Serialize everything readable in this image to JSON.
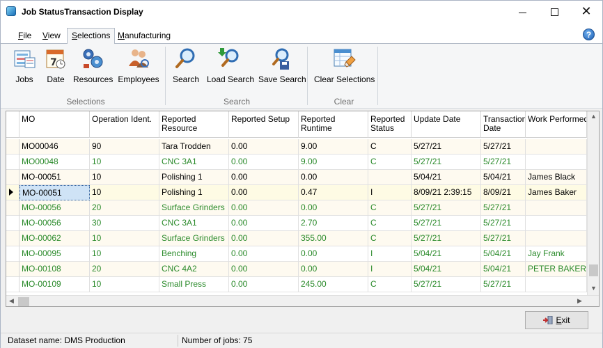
{
  "window": {
    "title": "Job StatusTransaction Display",
    "minimize_glyph": "",
    "close_glyph": "✕"
  },
  "menu": {
    "tabs": [
      {
        "label": "File",
        "underline": "F"
      },
      {
        "label": "View",
        "underline": "V"
      },
      {
        "label": "Selections",
        "underline": "S"
      },
      {
        "label": "Manufacturing",
        "underline": "M"
      }
    ],
    "help_glyph": "?"
  },
  "ribbon": {
    "groups": [
      {
        "label": "Selections",
        "buttons": [
          {
            "label": "Jobs",
            "icon": "jobs-icon"
          },
          {
            "label": "Date",
            "icon": "calendar-icon"
          },
          {
            "label": "Resources",
            "icon": "resources-gear-icon"
          },
          {
            "label": "Employees",
            "icon": "employees-icon"
          }
        ]
      },
      {
        "label": "Search",
        "buttons": [
          {
            "label": "Search",
            "icon": "magnifier-icon"
          },
          {
            "label": "Load Search",
            "icon": "load-search-icon"
          },
          {
            "label": "Save Search",
            "icon": "save-search-icon"
          }
        ]
      },
      {
        "label": "Clear",
        "buttons": [
          {
            "label": "Clear Selections",
            "icon": "clear-selections-icon"
          }
        ]
      }
    ]
  },
  "grid": {
    "columns": [
      "MO",
      "Operation Ident.",
      "Reported Resource",
      "Reported Setup",
      "Reported Runtime",
      "Reported Status",
      "Update Date",
      "Transaction Date",
      "Work Performed B"
    ],
    "rows": [
      {
        "mo": "MO00046",
        "op": "90",
        "resource": "Tara Trodden",
        "setup": "0.00",
        "runtime": "9.00",
        "status": "C",
        "update": "5/27/21",
        "trans": "5/27/21",
        "worker": "",
        "color": "black"
      },
      {
        "mo": "MO00048",
        "op": "10",
        "resource": "CNC 3A1",
        "setup": "0.00",
        "runtime": "9.00",
        "status": "C",
        "update": "5/27/21",
        "trans": "5/27/21",
        "worker": "",
        "color": "green"
      },
      {
        "mo": "MO-00051",
        "op": "10",
        "resource": "Polishing 1",
        "setup": "0.00",
        "runtime": "0.00",
        "status": "",
        "update": "5/04/21",
        "trans": "5/04/21",
        "worker": "James Black",
        "color": "black"
      },
      {
        "mo": "MO-00051",
        "op": "10",
        "resource": "Polishing 1",
        "setup": "0.00",
        "runtime": "0.47",
        "status": "I",
        "update": "8/09/21 2:39:15",
        "trans": "8/09/21",
        "worker": "James Baker",
        "color": "black",
        "current": true
      },
      {
        "mo": "MO-00056",
        "op": "20",
        "resource": "Surface Grinders",
        "setup": "0.00",
        "runtime": "0.00",
        "status": "C",
        "update": "5/27/21",
        "trans": "5/27/21",
        "worker": "",
        "color": "green"
      },
      {
        "mo": "MO-00056",
        "op": "30",
        "resource": "CNC 3A1",
        "setup": "0.00",
        "runtime": "2.70",
        "status": "C",
        "update": "5/27/21",
        "trans": "5/27/21",
        "worker": "",
        "color": "green"
      },
      {
        "mo": "MO-00062",
        "op": "10",
        "resource": "Surface Grinders",
        "setup": "0.00",
        "runtime": "355.00",
        "status": "C",
        "update": "5/27/21",
        "trans": "5/27/21",
        "worker": "",
        "color": "green"
      },
      {
        "mo": "MO-00095",
        "op": "10",
        "resource": "Benching",
        "setup": "0.00",
        "runtime": "0.00",
        "status": "I",
        "update": "5/04/21",
        "trans": "5/04/21",
        "worker": "Jay Frank",
        "color": "green"
      },
      {
        "mo": "MO-00108",
        "op": "20",
        "resource": "CNC 4A2",
        "setup": "0.00",
        "runtime": "0.00",
        "status": "I",
        "update": "5/04/21",
        "trans": "5/04/21",
        "worker": "PETER BAKER",
        "color": "green"
      },
      {
        "mo": "MO-00109",
        "op": "10",
        "resource": "Small Press",
        "setup": "0.00",
        "runtime": "245.00",
        "status": "C",
        "update": "5/27/21",
        "trans": "5/27/21",
        "worker": "",
        "color": "green"
      }
    ]
  },
  "buttons": {
    "exit_label": "Exit",
    "exit_underline": "E"
  },
  "status": {
    "dataset": "Dataset name:  DMS Production",
    "jobs": "Number of jobs: 75"
  },
  "colors": {
    "green_text": "#2a8a2a",
    "odd_row": "#fefaf0",
    "selection": "#cfe3f6"
  }
}
